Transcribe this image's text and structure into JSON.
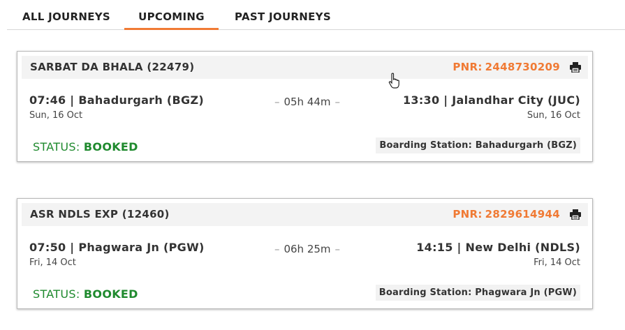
{
  "tabs": {
    "all": "ALL JOURNEYS",
    "upcoming": "UPCOMING",
    "past": "PAST JOURNEYS",
    "active": "upcoming"
  },
  "colors": {
    "accent": "#f07a34",
    "status_booked": "#1f8a2e"
  },
  "journeys": [
    {
      "train": "SARBAT DA BHALA (22479)",
      "pnr_label": "PNR:",
      "pnr": "2448730209",
      "departure_time": "07:46 | Bahadurgarh (BGZ)",
      "departure_date": "Sun, 16 Oct",
      "duration": "05h 44m",
      "arrival_time": "13:30 | Jalandhar City (JUC)",
      "arrival_date": "Sun, 16 Oct",
      "status_label": "STATUS:",
      "status": "BOOKED",
      "boarding": "Boarding Station: Bahadurgarh (BGZ)",
      "icon": "print-icon"
    },
    {
      "train": "ASR NDLS EXP (12460)",
      "pnr_label": "PNR:",
      "pnr": "2829614944",
      "departure_time": "07:50 | Phagwara Jn (PGW)",
      "departure_date": "Fri, 14 Oct",
      "duration": "06h 25m",
      "arrival_time": "14:15 | New Delhi (NDLS)",
      "arrival_date": "Fri, 14 Oct",
      "status_label": "STATUS:",
      "status": "BOOKED",
      "boarding": "Boarding Station: Phagwara Jn (PGW)",
      "icon": "print-icon"
    }
  ]
}
